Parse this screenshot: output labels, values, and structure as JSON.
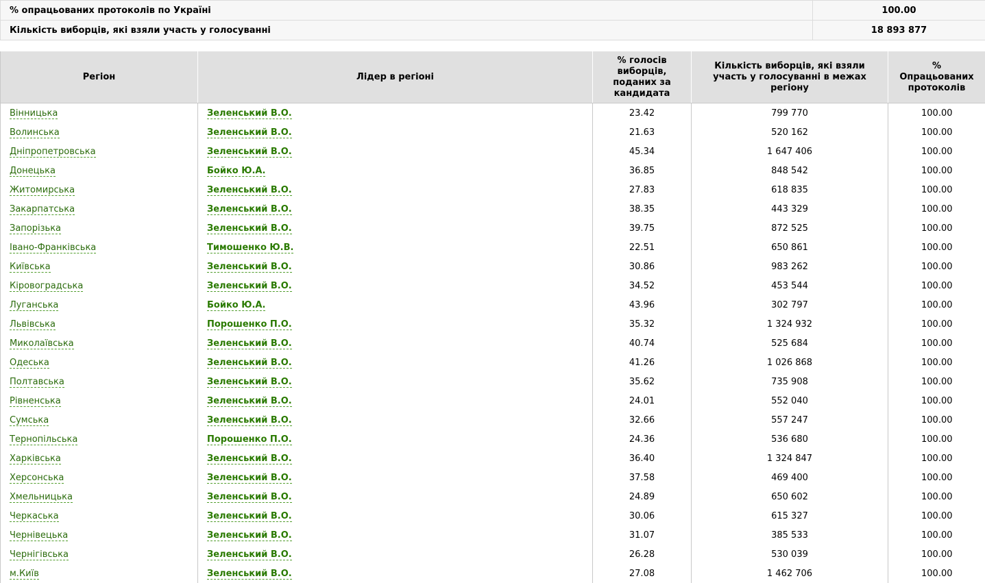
{
  "summary": [
    {
      "label": "% опрацьованих протоколів по Україні",
      "value": "100.00"
    },
    {
      "label": "Кількість виборців, які взяли участь у голосуванні",
      "value": "18 893 877"
    }
  ],
  "table": {
    "headers": [
      "Регіон",
      "Лідер в регіоні",
      "% голосів виборців, поданих за кандидата",
      "Кількість виборців, які взяли участь у голосуванні в межах регіону",
      "% Опрацьованих протоколів"
    ],
    "rows": [
      {
        "region": "Вінницька",
        "leader": "Зеленський В.О.",
        "pct": "23.42",
        "voters": "799 770",
        "protocols": "100.00"
      },
      {
        "region": "Волинська",
        "leader": "Зеленський В.О.",
        "pct": "21.63",
        "voters": "520 162",
        "protocols": "100.00"
      },
      {
        "region": "Дніпропетровська",
        "leader": "Зеленський В.О.",
        "pct": "45.34",
        "voters": "1 647 406",
        "protocols": "100.00"
      },
      {
        "region": "Донецька",
        "leader": "Бойко Ю.А.",
        "pct": "36.85",
        "voters": "848 542",
        "protocols": "100.00"
      },
      {
        "region": "Житомирська",
        "leader": "Зеленський В.О.",
        "pct": "27.83",
        "voters": "618 835",
        "protocols": "100.00"
      },
      {
        "region": "Закарпатська",
        "leader": "Зеленський В.О.",
        "pct": "38.35",
        "voters": "443 329",
        "protocols": "100.00"
      },
      {
        "region": "Запорізька",
        "leader": "Зеленський В.О.",
        "pct": "39.75",
        "voters": "872 525",
        "protocols": "100.00"
      },
      {
        "region": "Івано-Франківська",
        "leader": "Тимошенко Ю.В.",
        "pct": "22.51",
        "voters": "650 861",
        "protocols": "100.00"
      },
      {
        "region": "Київська",
        "leader": "Зеленський В.О.",
        "pct": "30.86",
        "voters": "983 262",
        "protocols": "100.00"
      },
      {
        "region": "Кіровоградська",
        "leader": "Зеленський В.О.",
        "pct": "34.52",
        "voters": "453 544",
        "protocols": "100.00"
      },
      {
        "region": "Луганська",
        "leader": "Бойко Ю.А.",
        "pct": "43.96",
        "voters": "302 797",
        "protocols": "100.00"
      },
      {
        "region": "Львівська",
        "leader": "Порошенко П.О.",
        "pct": "35.32",
        "voters": "1 324 932",
        "protocols": "100.00"
      },
      {
        "region": "Миколаївська",
        "leader": "Зеленський В.О.",
        "pct": "40.74",
        "voters": "525 684",
        "protocols": "100.00"
      },
      {
        "region": "Одеська",
        "leader": "Зеленський В.О.",
        "pct": "41.26",
        "voters": "1 026 868",
        "protocols": "100.00"
      },
      {
        "region": "Полтавська",
        "leader": "Зеленський В.О.",
        "pct": "35.62",
        "voters": "735 908",
        "protocols": "100.00"
      },
      {
        "region": "Рівненська",
        "leader": "Зеленський В.О.",
        "pct": "24.01",
        "voters": "552 040",
        "protocols": "100.00"
      },
      {
        "region": "Сумська",
        "leader": "Зеленський В.О.",
        "pct": "32.66",
        "voters": "557 247",
        "protocols": "100.00"
      },
      {
        "region": "Тернопільська",
        "leader": "Порошенко П.О.",
        "pct": "24.36",
        "voters": "536 680",
        "protocols": "100.00"
      },
      {
        "region": "Харківська",
        "leader": "Зеленський В.О.",
        "pct": "36.40",
        "voters": "1 324 847",
        "protocols": "100.00"
      },
      {
        "region": "Херсонська",
        "leader": "Зеленський В.О.",
        "pct": "37.58",
        "voters": "469 400",
        "protocols": "100.00"
      },
      {
        "region": "Хмельницька",
        "leader": "Зеленський В.О.",
        "pct": "24.89",
        "voters": "650 602",
        "protocols": "100.00"
      },
      {
        "region": "Черкаська",
        "leader": "Зеленський В.О.",
        "pct": "30.06",
        "voters": "615 327",
        "protocols": "100.00"
      },
      {
        "region": "Чернівецька",
        "leader": "Зеленський В.О.",
        "pct": "31.07",
        "voters": "385 533",
        "protocols": "100.00"
      },
      {
        "region": "Чернігівська",
        "leader": "Зеленський В.О.",
        "pct": "26.28",
        "voters": "530 039",
        "protocols": "100.00"
      },
      {
        "region": "м.Київ",
        "leader": "Зеленський В.О.",
        "pct": "27.08",
        "voters": "1 462 706",
        "protocols": "100.00"
      }
    ]
  },
  "colors": {
    "link": "#2a6b0b",
    "leader": "#2a7a00",
    "header_bg": "#e0e0e0"
  }
}
